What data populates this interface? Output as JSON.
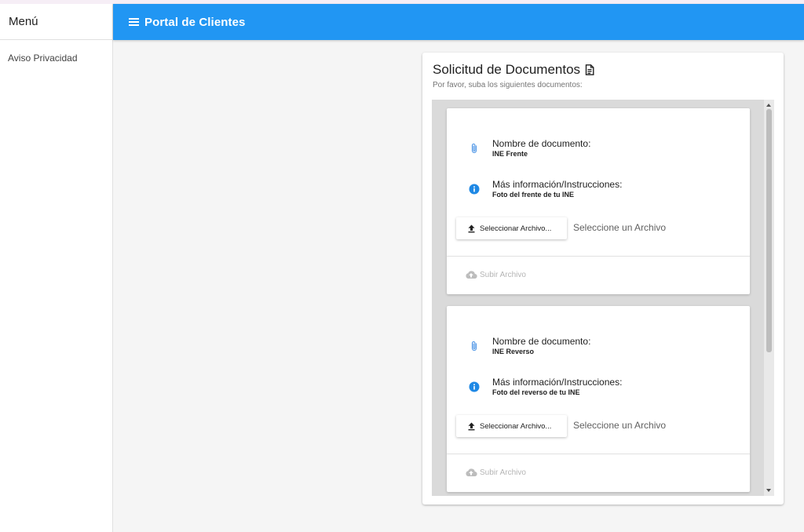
{
  "drawer": {
    "title": "Menú",
    "items": [
      {
        "label": "Aviso Privacidad"
      }
    ]
  },
  "appbar": {
    "title": "Portal de Clientes"
  },
  "card": {
    "title": "Solicitud de Documentos",
    "subtitle": "Por favor, suba los siguientes documentos:",
    "documents": [
      {
        "name_label": "Nombre de documento:",
        "name_value": "INE Frente",
        "info_label": "Más información/Instrucciones:",
        "info_value": "Foto del frente de tu INE",
        "select_label": "Seleccionar Archivo...",
        "file_status": "Seleccione un Archivo",
        "upload_label": "Subir Archivo"
      },
      {
        "name_label": "Nombre de documento:",
        "name_value": "INE Reverso",
        "info_label": "Más información/Instrucciones:",
        "info_value": "Foto del reverso de tu INE",
        "select_label": "Seleccionar Archivo...",
        "file_status": "Seleccione un Archivo",
        "upload_label": "Subir Archivo"
      }
    ]
  },
  "icons": {
    "menu": "hamburger-menu-icon",
    "doc": "file-document-icon",
    "attachment": "paperclip-icon",
    "info": "info-circle-icon",
    "select": "upload-arrow-icon",
    "upload": "cloud-upload-icon"
  },
  "colors": {
    "appbar": "#2196f3",
    "info_icon": "#1e88e5",
    "attachment_icon": "#5c9ee8",
    "disabled_text": "#b5b5b5"
  }
}
